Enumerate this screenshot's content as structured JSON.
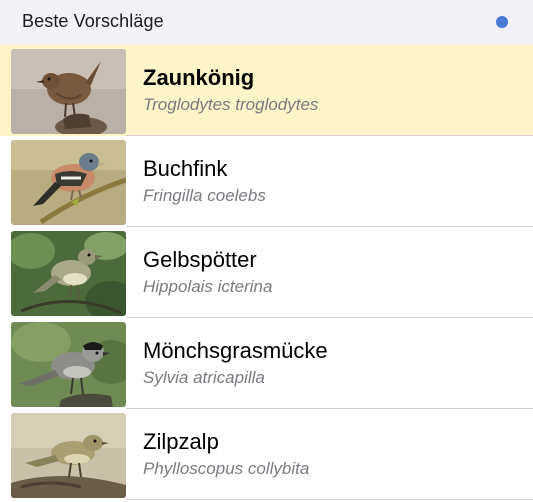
{
  "section": {
    "title": "Beste Vorschläge",
    "indicator_color": "#4a78d6"
  },
  "birds": [
    {
      "name": "Zaunkönig",
      "latin": "Troglodytes troglodytes",
      "icon": "wren-photo",
      "selected": true
    },
    {
      "name": "Buchfink",
      "latin": "Fringilla coelebs",
      "icon": "chaffinch-photo",
      "selected": false
    },
    {
      "name": "Gelbspötter",
      "latin": "Hippolais icterina",
      "icon": "icterine-warbler-photo",
      "selected": false
    },
    {
      "name": "Mönchsgrasmücke",
      "latin": "Sylvia atricapilla",
      "icon": "blackcap-photo",
      "selected": false
    },
    {
      "name": "Zilpzalp",
      "latin": "Phylloscopus collybita",
      "icon": "chiffchaff-photo",
      "selected": false
    }
  ],
  "colors": {
    "selected_row": "#fdf4c7",
    "header_bg": "#f2f2f7",
    "latin_text": "#7a7a80"
  }
}
